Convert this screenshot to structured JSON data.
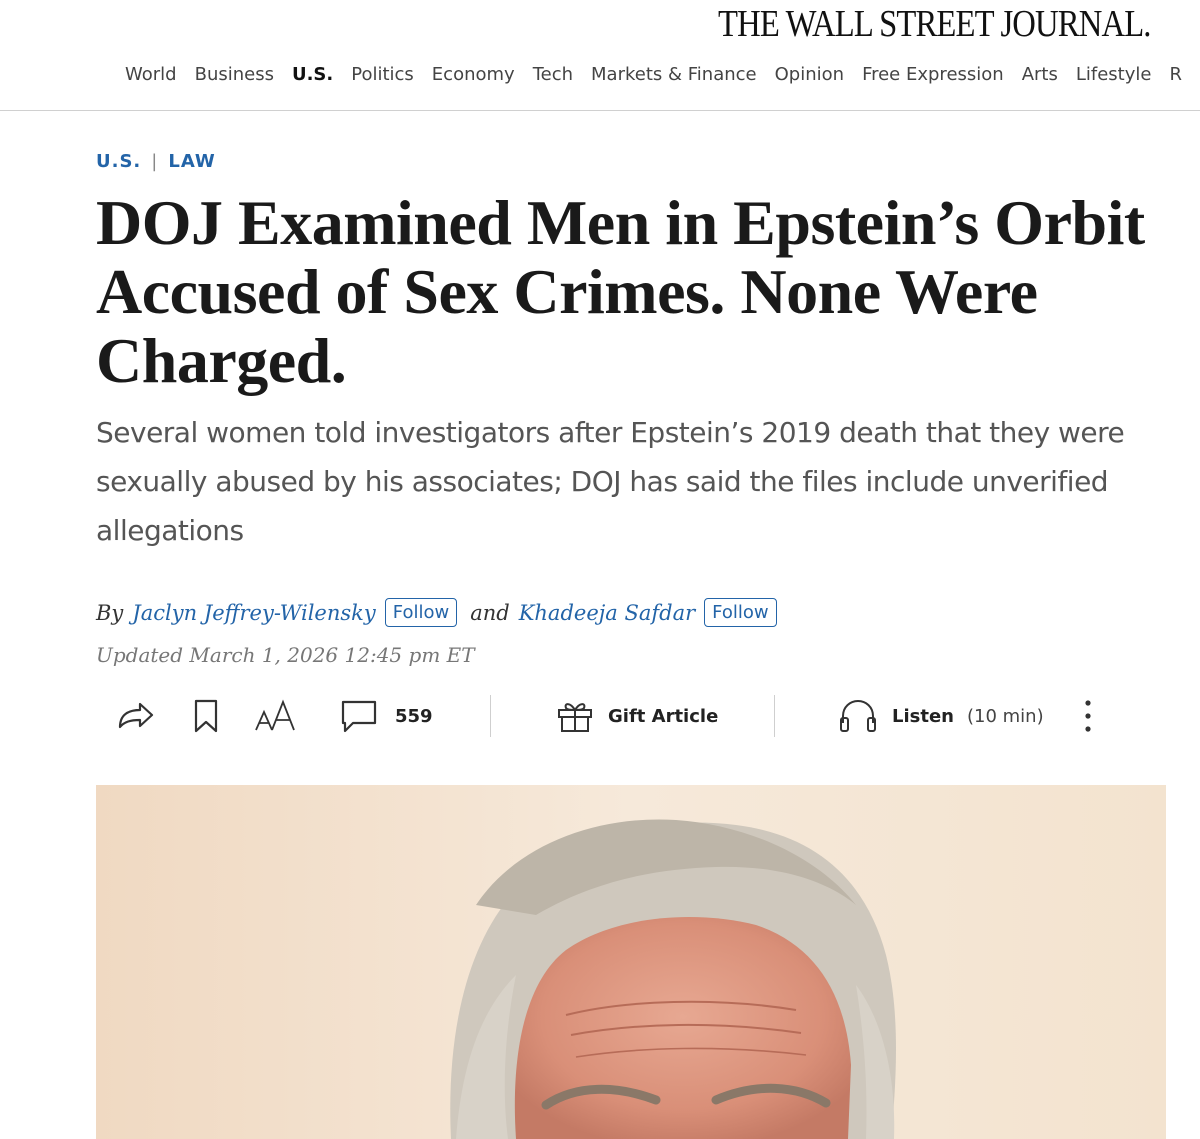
{
  "masthead": {
    "logo": "THE WALL STREET JOURNAL.",
    "nav": [
      "World",
      "Business",
      "U.S.",
      "Politics",
      "Economy",
      "Tech",
      "Markets & Finance",
      "Opinion",
      "Free Expression",
      "Arts",
      "Lifestyle",
      "R"
    ],
    "active_nav": "U.S."
  },
  "article": {
    "section": "U.S.",
    "subsection": "LAW",
    "headline": "DOJ Examined Men in Epstein’s Orbit Accused of Sex Crimes. None Were Charged.",
    "dek": "Several women told investigators after Epstein’s 2019 death that they were sexually abused by his associates; DOJ has said the files include unverified allegations",
    "byline": {
      "by": "By",
      "conjunction": "and",
      "authors": [
        "Jaclyn Jeffrey-Wilensky",
        "Khadeeja Safdar"
      ],
      "follow_label": "Follow"
    },
    "updated": "Updated March 1, 2026 12:45 pm ET"
  },
  "toolbar": {
    "comment_count": "559",
    "gift_label": "Gift Article",
    "listen_label": "Listen",
    "listen_duration": "(10 min)",
    "icons": [
      "share-icon",
      "bookmark-icon",
      "text-size-icon",
      "comment-icon",
      "gift-icon",
      "headphones-icon",
      "more-icon"
    ]
  },
  "hero_image": {
    "icon": "portrait-photo",
    "colors": {
      "background": "#f3e2cf",
      "skin": "#e3a089",
      "hair": "#d2cbc0"
    }
  },
  "colors": {
    "link": "#2364a8",
    "headline": "#1a1a1a",
    "dek": "#555555",
    "meta": "#777777",
    "divider": "#d0d0d0"
  }
}
